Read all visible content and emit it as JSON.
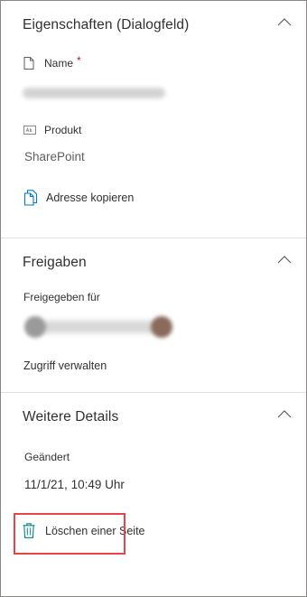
{
  "properties": {
    "title": "Eigenschaften (Dialogfeld)",
    "name_label": "Name",
    "required_marker": "*",
    "product_label": "Produkt",
    "product_value": "SharePoint",
    "copy_address_label": "Adresse kopieren"
  },
  "sharing": {
    "title": "Freigaben",
    "shared_with_label": "Freigegeben für",
    "manage_access_label": "Zugriff verwalten"
  },
  "details": {
    "title": "Weitere Details",
    "modified_label": "Geändert",
    "modified_date": "11/1/21,",
    "modified_time": "10:49 Uhr"
  },
  "actions": {
    "delete_page_label": "Löschen einer Seite"
  },
  "colors": {
    "accent": "#0078d4",
    "icon_teal": "#038387",
    "highlight": "#e8434a",
    "required": "#a4262c"
  }
}
